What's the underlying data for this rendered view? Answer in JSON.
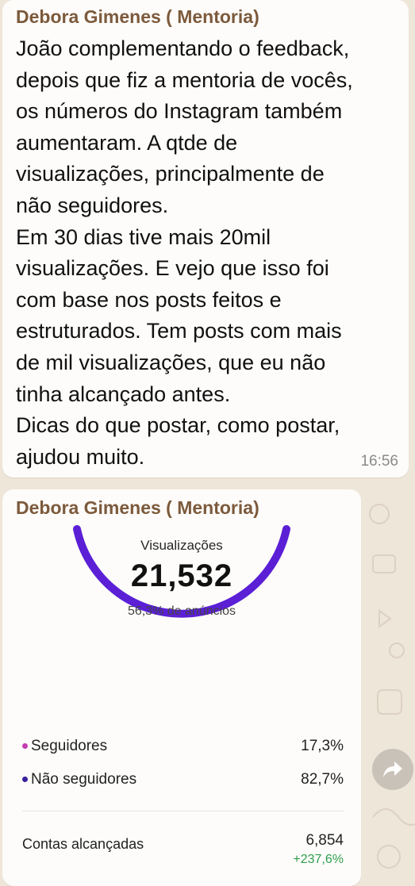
{
  "messages": [
    {
      "sender": "Debora Gimenes ( Mentoria)",
      "lines": [
        "João complementando o feedback,",
        "depois que fiz a mentoria de vocês,",
        "os números do Instagram também",
        "aumentaram. A qtde de",
        "visualizações, principalmente de",
        "não seguidores.",
        "Em 30 dias tive mais 20mil",
        "visualizações. E vejo que isso foi",
        "com base nos posts feitos e",
        "estruturados. Tem posts com mais",
        "de mil visualizações, que eu não",
        "tinha alcançado antes.",
        "Dicas do que postar, como postar,",
        "ajudou muito."
      ],
      "time": "16:56"
    },
    {
      "sender": "Debora Gimenes ( Mentoria)",
      "insights": {
        "views_label": "Visualizações",
        "views_value": "21,532",
        "ads_pct": "56,3% de anúncios",
        "breakdown": [
          {
            "label": "Seguidores",
            "value": "17,3%",
            "dot_color": "#c23fb0"
          },
          {
            "label": "Não seguidores",
            "value": "82,7%",
            "dot_color": "#3a1f9e"
          }
        ],
        "reach_label": "Contas alcançadas",
        "reach_value": "6,854",
        "reach_change": "+237,6%"
      }
    }
  ],
  "colors": {
    "ring": "#5b1fd6",
    "sender": "#7c5a3c",
    "positive_change": "#2e9e4c",
    "chat_background": "#efe6da"
  },
  "icons": {
    "forward": "forward-arrow-icon"
  }
}
